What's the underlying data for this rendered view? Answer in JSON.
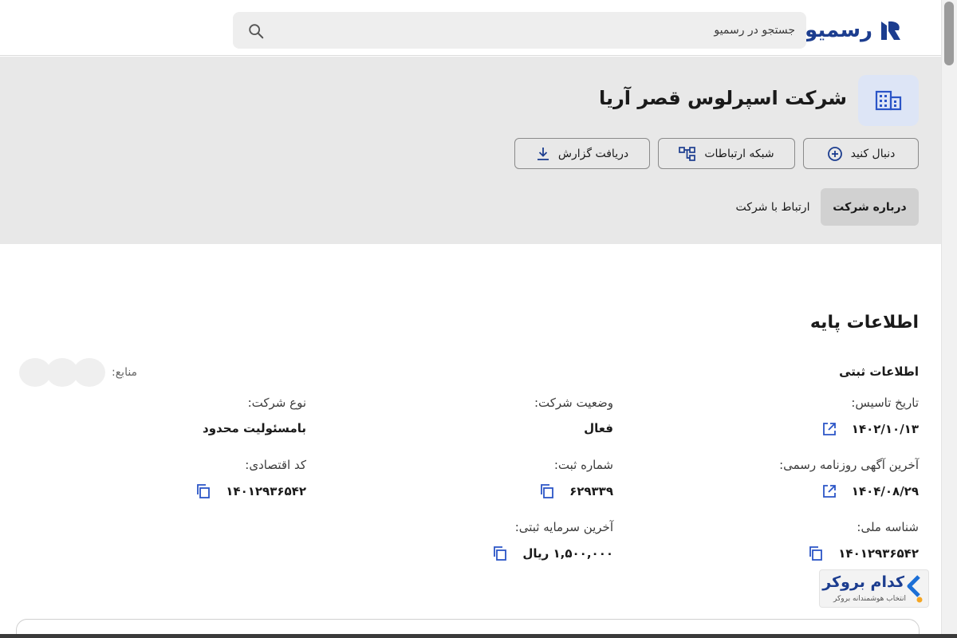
{
  "header": {
    "logo_text": "رسمیو",
    "search_placeholder": "جستجو در رسمیو"
  },
  "company": {
    "name": "شرکت اسپرلوس قصر آریا",
    "actions": {
      "follow": "دنبال کنید",
      "network": "شبکه ارتباطات",
      "report": "دریافت گزارش"
    },
    "tabs": [
      {
        "label": "درباره شرکت",
        "active": true
      },
      {
        "label": "ارتباط با شرکت",
        "active": false
      }
    ]
  },
  "basic_info": {
    "title": "اطلاعات پایه",
    "subtitle": "اطلاعات ثبتی",
    "sources_label": "منابع:",
    "fields": {
      "establishment_date": {
        "label": "تاریخ تاسیس:",
        "value": "۱۴۰۲/۱۰/۱۳"
      },
      "company_status": {
        "label": "وضعیت شرکت:",
        "value": "فعال"
      },
      "company_type": {
        "label": "نوع شرکت:",
        "value": "بامسئولیت محدود"
      },
      "last_gazette": {
        "label": "آخرین آگهی روزنامه رسمی:",
        "value": "۱۴۰۴/۰۸/۲۹"
      },
      "registration_number": {
        "label": "شماره ثبت:",
        "value": "۶۲۹۳۳۹"
      },
      "economic_code": {
        "label": "کد اقتصادی:",
        "value": "۱۴۰۱۲۹۳۶۵۴۲"
      },
      "national_id": {
        "label": "شناسه ملی:",
        "value": "۱۴۰۱۲۹۳۶۵۴۲"
      },
      "last_capital": {
        "label": "آخرین سرمایه ثبتی:",
        "value": "۱,۵۰۰,۰۰۰ ریال"
      }
    }
  },
  "broker": {
    "name": "کدام بروکر",
    "tagline": "انتخاب هوشمندانه بروکر"
  },
  "colors": {
    "brand": "#1c3d8f",
    "accent_blue": "#2b55c7",
    "header_gray": "#e8e8e8",
    "active_tab": "#d1d1d1",
    "broker_dot": "#f5a623"
  },
  "icons": {
    "logo": "rasmio-logo-icon",
    "search": "search-icon",
    "company": "building-icon",
    "follow": "plus-circle-icon",
    "network": "network-icon",
    "report": "download-icon",
    "external": "external-link-icon",
    "copy": "copy-icon"
  }
}
